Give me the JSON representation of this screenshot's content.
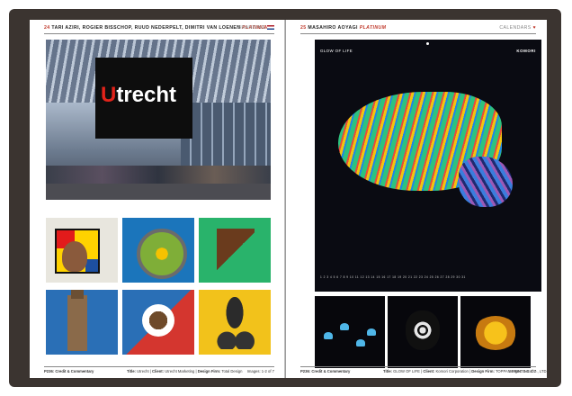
{
  "left_page": {
    "header": {
      "number": "24",
      "names": "TARI AZIRI, ROGIER BISSCHOP, RUUD NEDERPELT, DIMITRI VAN LOENEN",
      "award": "PLATINUM",
      "category": "BRANDING"
    },
    "photo": {
      "sign_text_red": "U",
      "sign_text": "trecht"
    },
    "footer": {
      "credit": "P236: Credit & Commentary",
      "title_label": "Title:",
      "title": "Utrecht",
      "client_label": "Client:",
      "client": "Utrecht Marketing",
      "firm_label": "Design Firm:",
      "firm": "Total Design",
      "images": "Images: 1-2 of 7"
    }
  },
  "right_page": {
    "header": {
      "number": "25",
      "names": "MASAHIRO AOYAGI",
      "award": "PLATINUM",
      "category": "CALENDARS"
    },
    "calendar": {
      "title": "GLOW OF LIFE",
      "brand": "KOMORI",
      "days_label": "1 2 3 4 5 6 7 8 9 10 11 12 13 14 15 16 17 18 19 20 21 22 23 24 25 26 27 28 29 30 31"
    },
    "footer": {
      "credit": "P236: Credit & Commentary",
      "title_label": "Title:",
      "title": "GLOW OF LIFE",
      "client_label": "Client:",
      "client": "Komori Corporation",
      "firm_label": "Design Firm:",
      "firm": "TOPPAN PRINTING CO., LTD.",
      "images": "Images: 1-4 of 7"
    }
  },
  "colors": {
    "accent": "#c0392b",
    "cover": "#3b3430"
  }
}
